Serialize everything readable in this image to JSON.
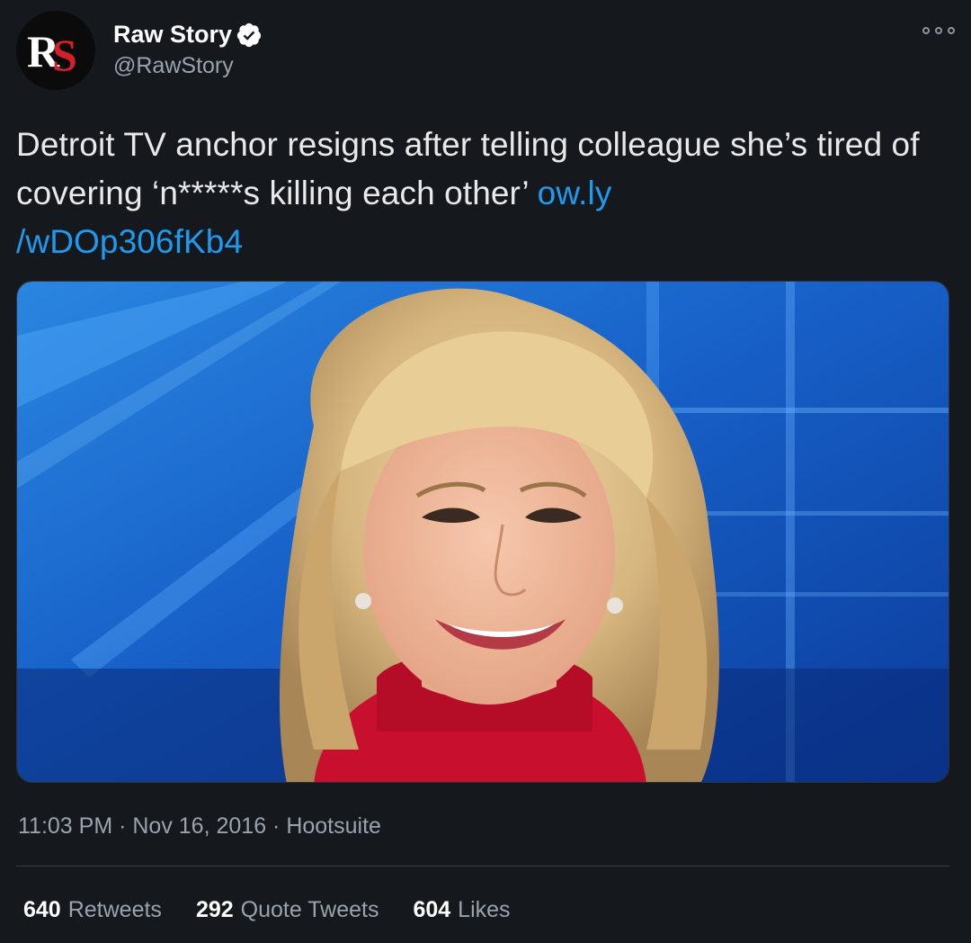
{
  "author": {
    "display_name": "Raw Story",
    "handle": "@RawStory",
    "avatar_text": "RS",
    "verified": true,
    "avatar_colors": {
      "background": "#0b0b0b",
      "letters": "#ffffff",
      "accent": "#d3202b"
    }
  },
  "tweet": {
    "text": "Detroit TV anchor resigns after telling colleague she’s tired of covering ‘n*****s killing each other’ ",
    "link_part1": "ow.ly",
    "link_part2": "/wDOp306fKb4"
  },
  "media": {
    "icon": "photo-news-anchor"
  },
  "meta": {
    "time": "11:03 PM",
    "separator": " · ",
    "date": "Nov 16, 2016",
    "source": "Hootsuite"
  },
  "stats": {
    "retweets_count": "640",
    "retweets_label": "Retweets",
    "quote_count": "292",
    "quote_label": "Quote Tweets",
    "likes_count": "604",
    "likes_label": "Likes"
  },
  "colors": {
    "background": "#15181d",
    "link": "#1d9bf0",
    "verified_badge": "#ffffff"
  }
}
